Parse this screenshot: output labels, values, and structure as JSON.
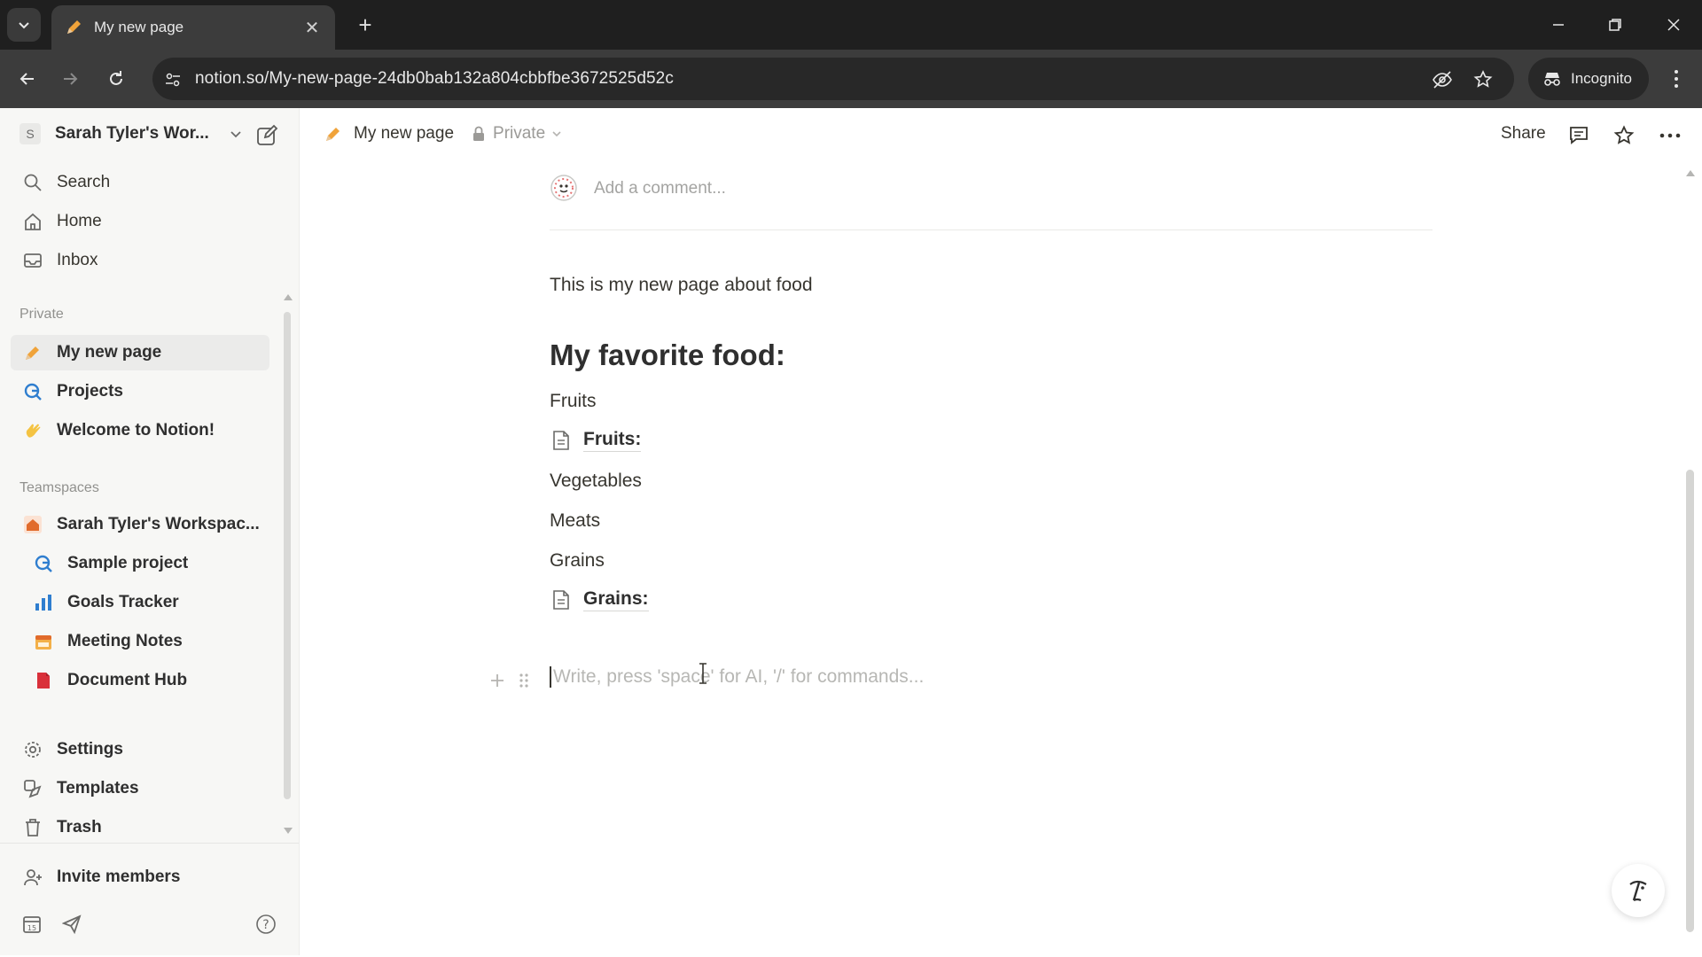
{
  "browser": {
    "tab_title": "My new page",
    "url": "notion.so/My-new-page-24db0bab132a804cbbfbe3672525d52c",
    "incognito_label": "Incognito"
  },
  "sidebar": {
    "workspace_initial": "S",
    "workspace_name": "Sarah Tyler's Wor...",
    "top_items": [
      {
        "label": "Search",
        "icon": "search-icon"
      },
      {
        "label": "Home",
        "icon": "home-icon"
      },
      {
        "label": "Inbox",
        "icon": "inbox-icon"
      }
    ],
    "private_label": "Private",
    "private_items": [
      {
        "label": "My new page",
        "icon": "pencil-emoji-icon",
        "active": true
      },
      {
        "label": "Projects",
        "icon": "projects-icon"
      },
      {
        "label": "Welcome to Notion!",
        "icon": "wave-emoji-icon"
      }
    ],
    "teamspaces_label": "Teamspaces",
    "teamspace_name": "Sarah Tyler's Workspac...",
    "teamspace_items": [
      {
        "label": "Sample project",
        "icon": "projects-icon"
      },
      {
        "label": "Goals Tracker",
        "icon": "chart-icon"
      },
      {
        "label": "Meeting Notes",
        "icon": "calendar-icon"
      },
      {
        "label": "Document Hub",
        "icon": "document-icon"
      }
    ],
    "utility_items": [
      {
        "label": "Settings",
        "icon": "gear-icon"
      },
      {
        "label": "Templates",
        "icon": "templates-icon"
      },
      {
        "label": "Trash",
        "icon": "trash-icon"
      }
    ],
    "invite_label": "Invite members"
  },
  "topbar": {
    "page_title": "My new page",
    "privacy": "Private",
    "share_label": "Share"
  },
  "page": {
    "comment_placeholder": "Add a comment...",
    "intro": "This is my new page about food",
    "heading": "My favorite food:",
    "line_fruits": "Fruits",
    "link_fruits": "Fruits:",
    "line_vegetables": "Vegetables",
    "line_meats": "Meats",
    "line_grains": "Grains",
    "link_grains": "Grains:",
    "empty_placeholder": "Write, press 'space' for AI, '/' for commands..."
  },
  "colors": {
    "accent_orange": "#e16b2b",
    "sidebar_bg": "#f7f7f5",
    "text": "#37352f"
  }
}
